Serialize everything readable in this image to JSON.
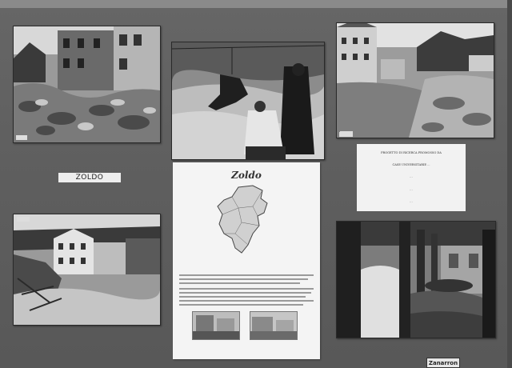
{
  "board": {
    "region_label": "ZOLDO"
  },
  "notice": {
    "lines": [
      "PROGETTO DI RICERCA PROMOSSO DA",
      "CASE UNIVERSITARIE ...",
      "...",
      "...",
      "..."
    ]
  },
  "info_panel": {
    "title": "Zoldo"
  },
  "sign": {
    "text": "Zanarron"
  },
  "colors": {
    "board": "#5e5e5e",
    "paper": "#f4f4f4",
    "photo_dark": "#2b2b2b"
  }
}
